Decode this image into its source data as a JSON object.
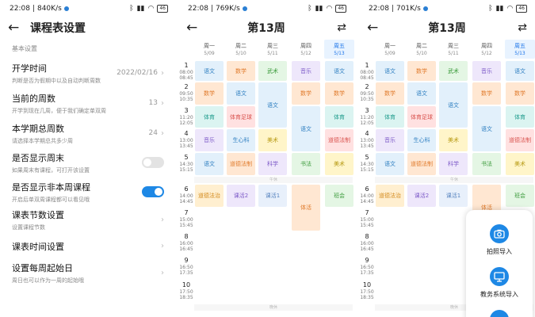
{
  "settings_screen": {
    "status": {
      "time": "22:08",
      "speed": "840K/s",
      "battery": "46"
    },
    "title": "课程表设置",
    "section": "基本设置",
    "items": [
      {
        "title": "开学时间",
        "subtitle": "判断是否为假期中以及自动判断周数",
        "value": "2022/02/16",
        "type": "value"
      },
      {
        "title": "当前的周数",
        "subtitle": "开学到现在几周，便于我们确定单双周",
        "value": "13",
        "type": "value"
      },
      {
        "title": "本学期总周数",
        "subtitle": "请选择本学期总共多少周",
        "value": "24",
        "type": "value"
      },
      {
        "title": "是否显示周末",
        "subtitle": "如果周末有课程，可打开该设置",
        "value": "",
        "type": "toggle",
        "on": false
      },
      {
        "title": "是否显示非本周课程",
        "subtitle": "开启后单双周课程都可以看见哦",
        "value": "",
        "type": "toggle",
        "on": true
      },
      {
        "title": "课表节数设置",
        "subtitle": "设置课程节数",
        "value": "",
        "type": "chevron"
      },
      {
        "title": "课表时间设置",
        "subtitle": "",
        "value": "",
        "type": "chevron"
      },
      {
        "title": "设置每周起始日",
        "subtitle": "周日也可以作为一周的起始哦",
        "value": "",
        "type": "chevron"
      }
    ]
  },
  "timetable": {
    "title": "第13周",
    "lunch_label": "午休",
    "dinner_label": "晚休",
    "days": [
      {
        "name": "周一",
        "date": "5/09"
      },
      {
        "name": "周二",
        "date": "5/10"
      },
      {
        "name": "周三",
        "date": "5/11"
      },
      {
        "name": "周四",
        "date": "5/12"
      },
      {
        "name": "周五",
        "date": "5/13"
      }
    ],
    "periods": [
      {
        "num": "1",
        "start": "08:00",
        "end": "08:45"
      },
      {
        "num": "2",
        "start": "09:50",
        "end": "10:35"
      },
      {
        "num": "3",
        "start": "11:20",
        "end": "12:05"
      },
      {
        "num": "4",
        "start": "13:00",
        "end": "13:45"
      },
      {
        "num": "5",
        "start": "14:30",
        "end": "15:15"
      },
      {
        "num": "6",
        "start": "14:00",
        "end": "14:45"
      },
      {
        "num": "7",
        "start": "15:00",
        "end": "15:45"
      },
      {
        "num": "8",
        "start": "16:00",
        "end": "16:45"
      },
      {
        "num": "9",
        "start": "16:50",
        "end": "17:35"
      },
      {
        "num": "10",
        "start": "17:50",
        "end": "18:35"
      }
    ],
    "courses": [
      {
        "day": 0,
        "start": 1,
        "span": 1,
        "name": "语文",
        "color": "#e2f0fb",
        "text": "#2f7fc1"
      },
      {
        "day": 0,
        "start": 2,
        "span": 1,
        "name": "数学",
        "color": "#ffe7d2",
        "text": "#e07a2a"
      },
      {
        "day": 0,
        "start": 3,
        "span": 1,
        "name": "体育",
        "color": "#dbf4f1",
        "text": "#1f9c8c"
      },
      {
        "day": 0,
        "start": 4,
        "span": 1,
        "name": "音乐",
        "color": "#eee7fb",
        "text": "#7e5bc8"
      },
      {
        "day": 0,
        "start": 5,
        "span": 1,
        "name": "语文",
        "color": "#e2f0fb",
        "text": "#2f7fc1"
      },
      {
        "day": 0,
        "start": 6,
        "span": 1,
        "name": "道德法治",
        "color": "#ffefd0",
        "text": "#d38a1c"
      },
      {
        "day": 1,
        "start": 1,
        "span": 1,
        "name": "数学",
        "color": "#ffe7d2",
        "text": "#e07a2a"
      },
      {
        "day": 1,
        "start": 2,
        "span": 1,
        "name": "语文",
        "color": "#e2f0fb",
        "text": "#2f7fc1"
      },
      {
        "day": 1,
        "start": 3,
        "span": 1,
        "name": "体育足球",
        "color": "#ffe1e1",
        "text": "#d9534f"
      },
      {
        "day": 1,
        "start": 4,
        "span": 1,
        "name": "生心科",
        "color": "#e2f0fb",
        "text": "#2f7fc1"
      },
      {
        "day": 1,
        "start": 5,
        "span": 1,
        "name": "道德法制",
        "color": "#ffe7d2",
        "text": "#e07a2a"
      },
      {
        "day": 1,
        "start": 6,
        "span": 1,
        "name": "课活2",
        "color": "#eee7fb",
        "text": "#7e5bc8"
      },
      {
        "day": 2,
        "start": 1,
        "span": 1,
        "name": "武术",
        "color": "#e4f6e4",
        "text": "#3a9a3a"
      },
      {
        "day": 2,
        "start": 2,
        "span": 2,
        "name": "语文",
        "color": "#e2f0fb",
        "text": "#2f7fc1"
      },
      {
        "day": 2,
        "start": 4,
        "span": 1,
        "name": "美术",
        "color": "#fff5c9",
        "text": "#b79a12"
      },
      {
        "day": 2,
        "start": 5,
        "span": 1,
        "name": "科学",
        "color": "#eee7fb",
        "text": "#7e5bc8"
      },
      {
        "day": 2,
        "start": 6,
        "span": 1,
        "name": "课活1",
        "color": "#e8f0fb",
        "text": "#5a86c0"
      },
      {
        "day": 3,
        "start": 1,
        "span": 1,
        "name": "音乐",
        "color": "#eee7fb",
        "text": "#7e5bc8"
      },
      {
        "day": 3,
        "start": 2,
        "span": 1,
        "name": "数学",
        "color": "#ffe7d2",
        "text": "#e07a2a"
      },
      {
        "day": 3,
        "start": 3,
        "span": 2,
        "name": "语文",
        "color": "#e2f0fb",
        "text": "#2f7fc1"
      },
      {
        "day": 3,
        "start": 5,
        "span": 1,
        "name": "书法",
        "color": "#e4f6e4",
        "text": "#3a9a3a"
      },
      {
        "day": 3,
        "start": 6,
        "span": 2,
        "name": "体活",
        "color": "#ffe7d2",
        "text": "#e07a2a"
      },
      {
        "day": 4,
        "start": 1,
        "span": 1,
        "name": "语文",
        "color": "#e2f0fb",
        "text": "#2f7fc1"
      },
      {
        "day": 4,
        "start": 2,
        "span": 1,
        "name": "数学",
        "color": "#ffe7d2",
        "text": "#e07a2a"
      },
      {
        "day": 4,
        "start": 3,
        "span": 1,
        "name": "体育",
        "color": "#dbf4f1",
        "text": "#1f9c8c"
      },
      {
        "day": 4,
        "start": 4,
        "span": 1,
        "name": "道德法制",
        "color": "#ffe1e1",
        "text": "#d9534f"
      },
      {
        "day": 4,
        "start": 5,
        "span": 1,
        "name": "美术",
        "color": "#fff5c9",
        "text": "#b79a12"
      },
      {
        "day": 4,
        "start": 6,
        "span": 1,
        "name": "班会",
        "color": "#e4f6e4",
        "text": "#3a9a3a"
      }
    ]
  },
  "screen2": {
    "status": {
      "time": "22:08",
      "speed": "769K/s",
      "battery": "46"
    }
  },
  "screen3": {
    "status": {
      "time": "22:08",
      "speed": "701K/s",
      "battery": "46"
    },
    "popup": {
      "photo_import": "拍照导入",
      "system_import": "教务系统导入"
    }
  },
  "accent": "#1e88e5"
}
